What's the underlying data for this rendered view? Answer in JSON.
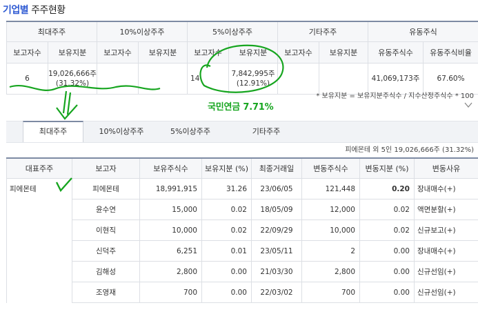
{
  "page_title": {
    "accent": "기업별",
    "rest": " 주주현황"
  },
  "summary": {
    "groups": [
      "최대주주",
      "10%이상주주",
      "5%이상주주",
      "기타주주",
      "유동주식"
    ],
    "subheaders": [
      "보고자수",
      "보유지분",
      "보고자수",
      "보유지분",
      "보고자수",
      "보유지분",
      "보고자수",
      "보유지분",
      "유동주식수",
      "유동주식비율"
    ],
    "row": {
      "largest_count": "6",
      "largest_shares": "19,026,666주",
      "largest_pct": "(31.32%)",
      "ten_count": "",
      "ten_shares": "",
      "five_count": "14",
      "five_shares": "7,842,995주",
      "five_pct": "(12.91%)",
      "other_count": "",
      "other_shares": "",
      "float_shares": "41,069,173주",
      "float_ratio": "67.60%"
    },
    "note": "* 보유지분 = 보유지분주식수 / 지수산정주식수 * 100"
  },
  "annotation": {
    "text": "국민연금 7.71%",
    "color": "#16a51f"
  },
  "tabs": [
    "최대주주",
    "10%이상주주",
    "5%이상주주",
    "기타주주"
  ],
  "group_summary": "피에몬테 외 5인 19,026,666주 (31.32%)",
  "detail": {
    "headers": [
      "대표주주",
      "보고자",
      "보유주식수",
      "보유지분 (%)",
      "최종거래일",
      "변동주식수",
      "변동지분 (%)",
      "변동사유"
    ],
    "representative": "피에몬테",
    "rows": [
      {
        "reporter": "피에몬테",
        "shares": "18,991,915",
        "pct": "31.26",
        "date": "23/06/05",
        "chg": "121,448",
        "chg_pct": "0.20",
        "reason": "장내매수(+)"
      },
      {
        "reporter": "윤수연",
        "shares": "15,000",
        "pct": "0.02",
        "date": "18/05/09",
        "chg": "12,000",
        "chg_pct": "0.02",
        "reason": "액면분할(+)"
      },
      {
        "reporter": "이현직",
        "shares": "10,000",
        "pct": "0.02",
        "date": "22/09/29",
        "chg": "10,000",
        "chg_pct": "0.02",
        "reason": "신규보고(+)"
      },
      {
        "reporter": "신덕주",
        "shares": "6,251",
        "pct": "0.01",
        "date": "23/05/11",
        "chg": "2",
        "chg_pct": "0.00",
        "reason": "장내매수(+)"
      },
      {
        "reporter": "김해성",
        "shares": "2,800",
        "pct": "0.00",
        "date": "21/03/30",
        "chg": "2,800",
        "chg_pct": "0.00",
        "reason": "신규선임(+)"
      },
      {
        "reporter": "조영재",
        "shares": "700",
        "pct": "0.00",
        "date": "22/03/02",
        "chg": "700",
        "chg_pct": "0.00",
        "reason": "신규선임(+)"
      }
    ]
  }
}
